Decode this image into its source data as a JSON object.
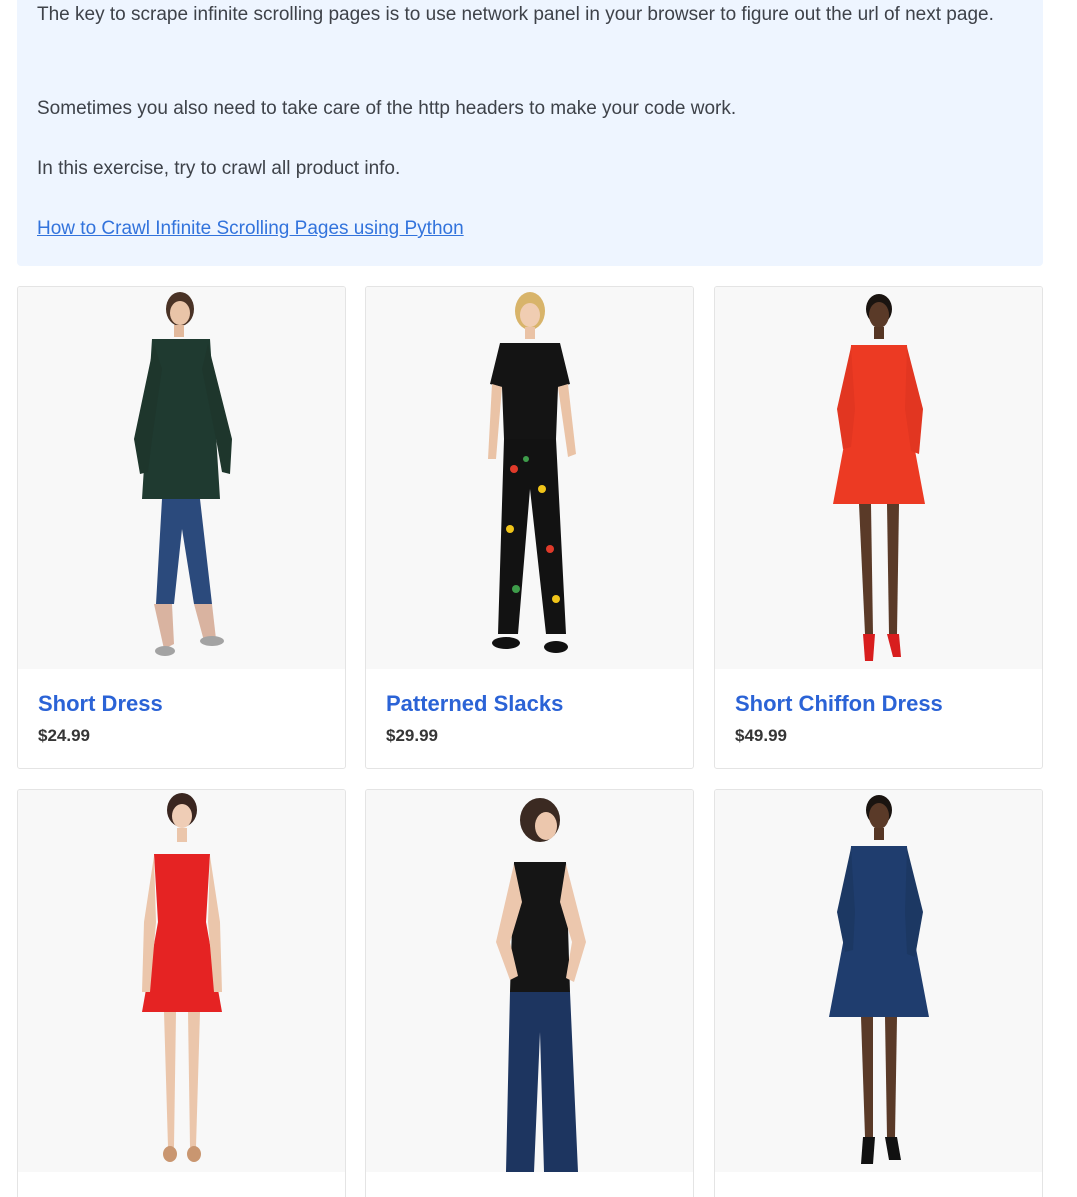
{
  "intro": {
    "paragraph1": "The key to scrape infinite scrolling pages is to use network panel in your browser to figure out the url of next page.",
    "paragraph2": "Sometimes you also need to take care of the http headers to make your code work.",
    "paragraph3": "In this exercise, try to crawl all product info.",
    "tutorial_link": "How to Crawl Infinite Scrolling Pages using Python"
  },
  "products": [
    {
      "name": "Short Dress",
      "price": "$24.99",
      "image": "model-dark-green-dress-jeans"
    },
    {
      "name": "Patterned Slacks",
      "price": "$29.99",
      "image": "model-black-top-floral-pants"
    },
    {
      "name": "Short Chiffon Dress",
      "price": "$49.99",
      "image": "model-red-chiffon-dress"
    },
    {
      "name": "",
      "price": "",
      "image": "model-red-short-dress"
    },
    {
      "name": "",
      "price": "",
      "image": "model-black-top-jeans"
    },
    {
      "name": "",
      "price": "",
      "image": "model-navy-dress"
    }
  ],
  "colors": {
    "info_bg": "#eef5ff",
    "link": "#3273dc",
    "product_title": "#2b63d6"
  }
}
